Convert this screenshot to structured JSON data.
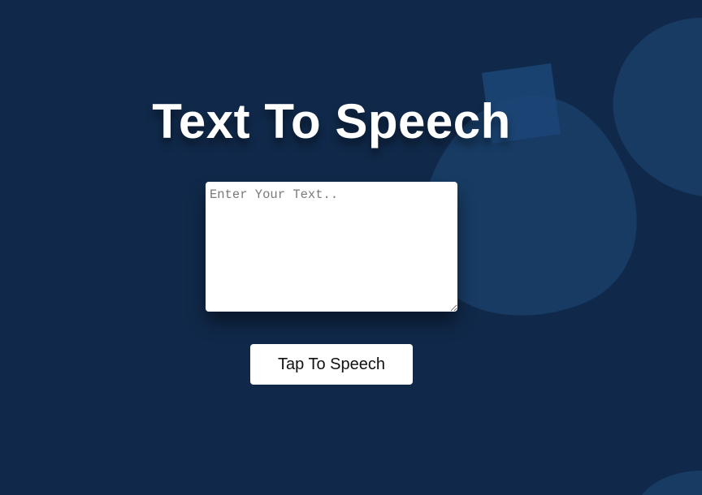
{
  "page": {
    "title": "Text To Speech"
  },
  "form": {
    "textarea_value": "",
    "textarea_placeholder": "Enter Your Text..",
    "button_label": "Tap To Speech"
  },
  "colors": {
    "background": "#10294a",
    "shape": "#173b63",
    "shape_light": "#1c4677",
    "title_text": "#ffffff",
    "button_background": "#ffffff",
    "button_text": "#111111"
  }
}
